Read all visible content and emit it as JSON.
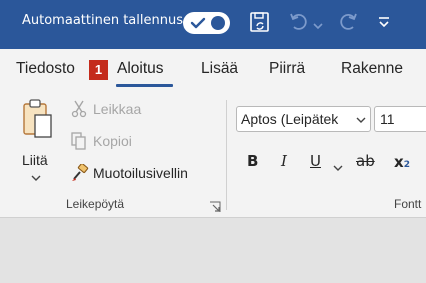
{
  "titlebar": {
    "autosave_label": "Automaattinen tallennus",
    "autosave_on": true,
    "bg_color": "#2b579a",
    "qat_icons": [
      "save-sync-icon",
      "undo-icon",
      "chevron-down-icon",
      "redo-icon",
      "customize-qat-icon"
    ]
  },
  "tabs": {
    "file": "Tiedosto",
    "file_badge": "1",
    "home": "Aloitus",
    "insert": "Lisää",
    "draw": "Piirrä",
    "design": "Rakenne",
    "active": "Aloitus"
  },
  "clipboard": {
    "paste": "Liitä",
    "cut": "Leikkaa",
    "copy": "Kopioi",
    "format_painter": "Muotoilusivellin",
    "group_label": "Leikepöytä"
  },
  "font": {
    "font_name": "Aptos (Leipätek",
    "font_size": "11",
    "bold": "B",
    "italic": "I",
    "underline": "U",
    "strikethrough": "ab",
    "subscript": "x",
    "subscript_mark": "2",
    "group_label": "Fontt"
  }
}
